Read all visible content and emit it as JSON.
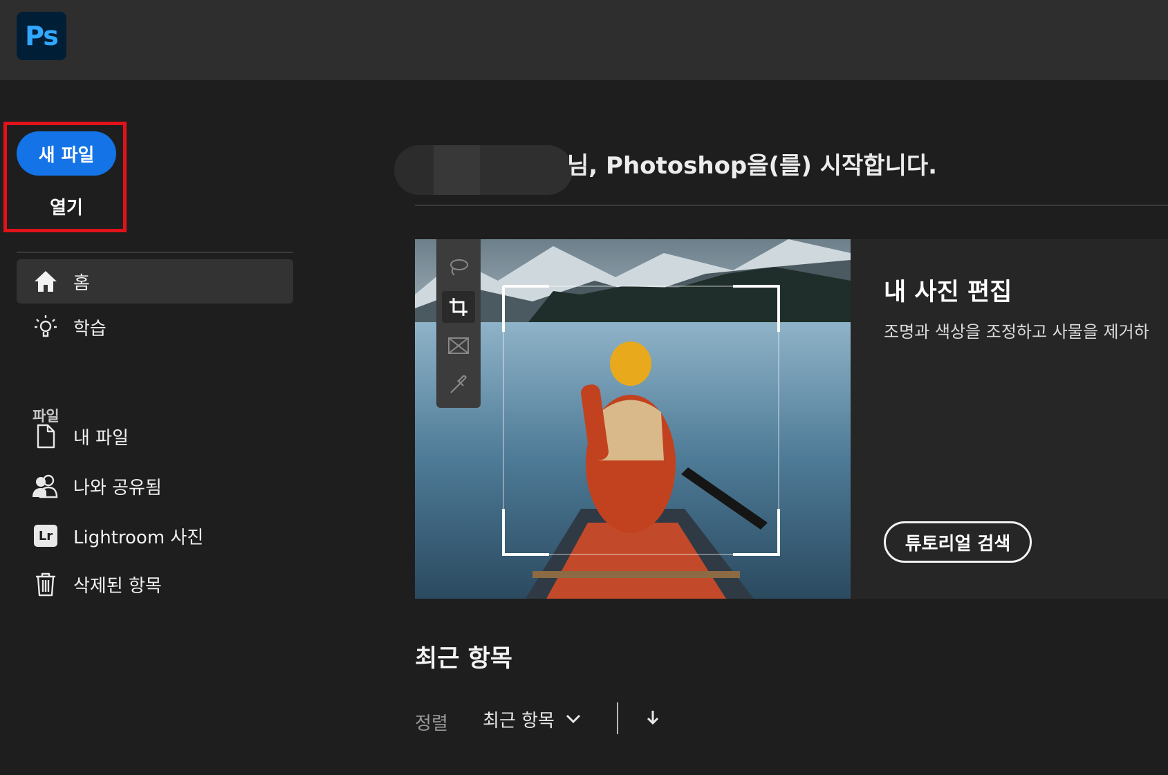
{
  "app": {
    "logo_text": "Ps",
    "brand_color": "#31a8ff",
    "accent": "#1473e6",
    "highlight": "#e0121a"
  },
  "sidebar": {
    "new_file": "새 파일",
    "open": "열기",
    "nav": [
      {
        "label": "홈",
        "icon": "home-icon",
        "active": true
      },
      {
        "label": "학습",
        "icon": "lightbulb-icon",
        "active": false
      }
    ],
    "files_section": "파일",
    "files": [
      {
        "label": "내 파일",
        "icon": "document-icon"
      },
      {
        "label": "나와 공유됨",
        "icon": "people-icon"
      },
      {
        "label": "Lightroom 사진",
        "icon": "lightroom-icon",
        "icon_text": "Lr"
      },
      {
        "label": "삭제된 항목",
        "icon": "trash-icon"
      }
    ]
  },
  "main": {
    "greeting": "님, Photoshop을(를) 시작합니다.",
    "hero": {
      "title": "내 사진 편집",
      "subtitle": "조명과 색상을 조정하고 사물을 제거하",
      "button": "튜토리얼 검색",
      "tools": [
        "lasso-icon",
        "crop-icon",
        "frame-icon",
        "eyedropper-icon"
      ]
    },
    "recent": {
      "title": "최근 항목",
      "sort_label": "정렬",
      "sort_value": "최근 항목"
    }
  }
}
